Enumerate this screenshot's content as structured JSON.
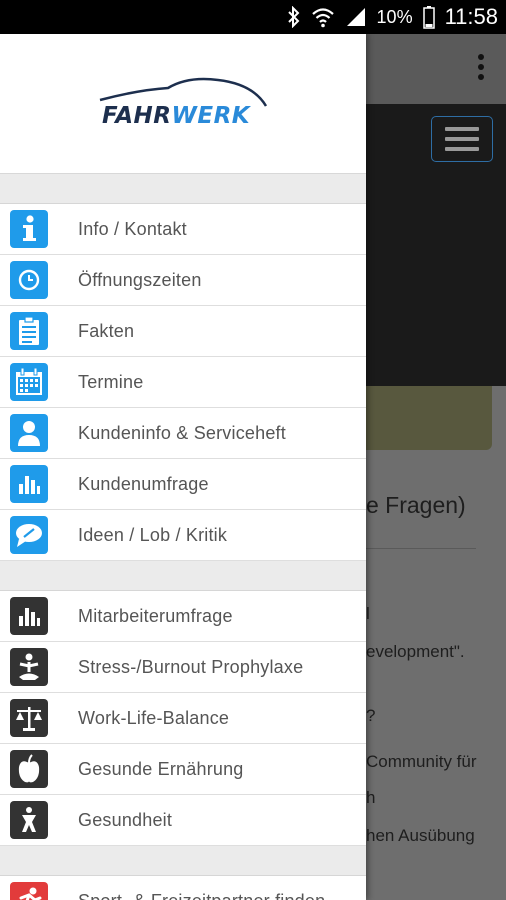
{
  "status_bar": {
    "battery_percent": "10%",
    "time": "11:58"
  },
  "app_bar": {
    "more_icon": "more-vert-icon",
    "menu_icon": "hamburger-icon"
  },
  "drawer": {
    "logo": {
      "part1": "FAHR",
      "part2": "WERK"
    },
    "customer_items": [
      {
        "label": "Info / Kontakt",
        "icon": "info-icon"
      },
      {
        "label": "Öffnungszeiten",
        "icon": "clock-icon"
      },
      {
        "label": "Fakten",
        "icon": "clipboard-icon"
      },
      {
        "label": "Termine",
        "icon": "calendar-icon"
      },
      {
        "label": "Kundeninfo & Serviceheft",
        "icon": "person-icon"
      },
      {
        "label": "Kundenumfrage",
        "icon": "bar-chart-icon"
      },
      {
        "label": "Ideen / Lob / Kritik",
        "icon": "comment-icon"
      }
    ],
    "employee_items": [
      {
        "label": "Mitarbeiterumfrage",
        "icon": "bar-chart-icon"
      },
      {
        "label": "Stress-/Burnout Prophylaxe",
        "icon": "meditation-icon"
      },
      {
        "label": "Work-Life-Balance",
        "icon": "scale-icon"
      },
      {
        "label": "Gesunde Ernährung",
        "icon": "apple-icon"
      },
      {
        "label": "Gesundheit",
        "icon": "health-icon"
      }
    ],
    "sport_items": [
      {
        "label": "Sport- & Freizeitpartner finden",
        "icon": "runner-icon"
      }
    ]
  },
  "background_content": {
    "heading_fragment": "e Fragen)",
    "line1": "l",
    "line2": "evelopment\".",
    "line3": "?",
    "line4": "Community für",
    "line5": "h",
    "line6": "hen Ausübung"
  },
  "colors": {
    "accent_blue": "#1f9bea",
    "icon_dark": "#333333",
    "icon_red": "#e23b3b"
  }
}
